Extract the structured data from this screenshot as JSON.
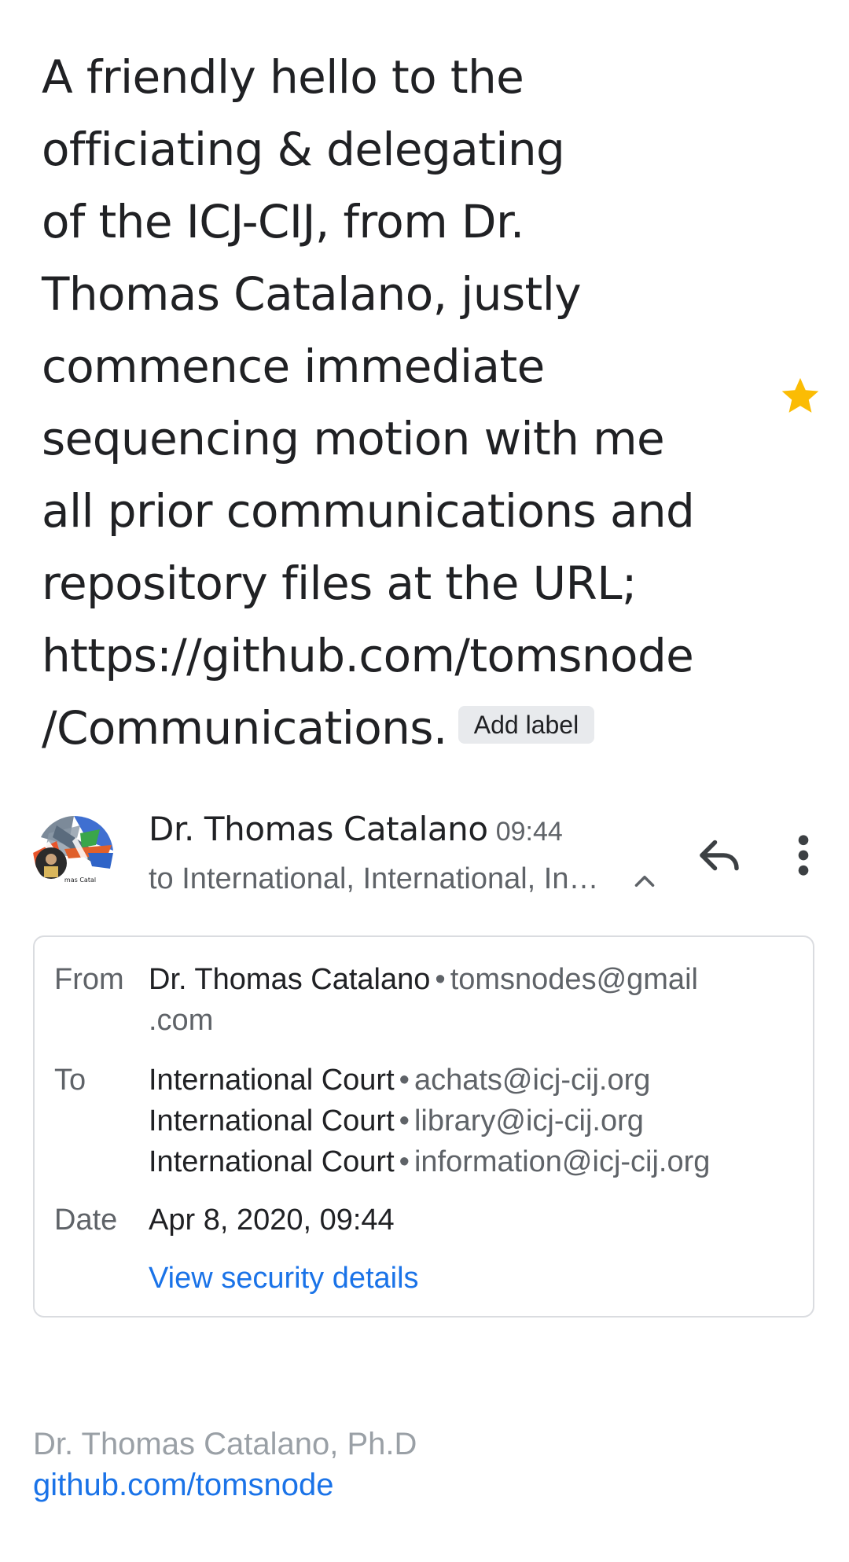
{
  "subject": {
    "lines": [
      "A friendly hello to the",
      "officiating & delegating",
      "of the ICJ-CIJ, from Dr.",
      "Thomas Catalano, justly",
      "commence immediate",
      "sequencing motion with me",
      "all prior communications and",
      "repository files at the URL;",
      "https://github.com/tomsnode",
      "/Communications."
    ],
    "add_label": "Add label",
    "starred": true,
    "star_color": "#fbbc04"
  },
  "message": {
    "sender_name": "Dr. Thomas Catalano",
    "time": "09:44",
    "recipients_summary": "to International, International, In…",
    "avatar_icon": "avatar-icon",
    "reply_icon": "reply-icon",
    "more_icon": "more-vert-icon",
    "expand_icon": "chevron-up-icon"
  },
  "details": {
    "from_label": "From",
    "from_name": "Dr. Thomas Catalano",
    "from_email_part1": "tomsnodes@gmail",
    "from_email_part2": ".com",
    "to_label": "To",
    "to": [
      {
        "name": "International Court",
        "email": "achats@icj-cij.org"
      },
      {
        "name": "International Court",
        "email": "library@icj-cij.org"
      },
      {
        "name": "International Court",
        "email": "information@icj-cij.org"
      }
    ],
    "date_label": "Date",
    "date_value": "Apr 8, 2020, 09:44",
    "security_link": "View security details"
  },
  "signature": {
    "name": "Dr. Thomas Catalano, Ph.D",
    "link": "github.com/tomsnode"
  },
  "colors": {
    "accent": "#1a73e8",
    "text": "#202124",
    "secondary": "#5f6368",
    "muted": "#9aa0a6"
  }
}
